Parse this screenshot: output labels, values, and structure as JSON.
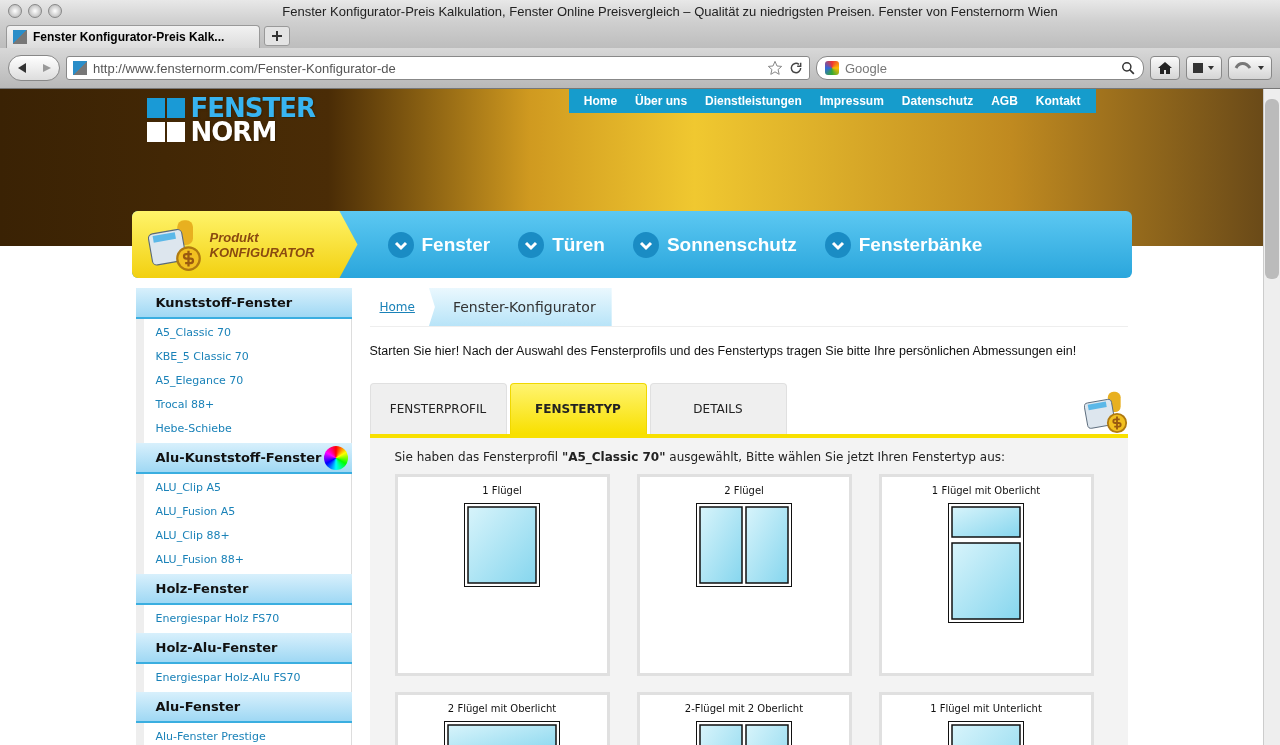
{
  "browser": {
    "window_title": "Fenster Konfigurator-Preis Kalkulation, Fenster Online Preisvergleich – Qualität zu niedrigsten Preisen. Fenster von Fensternorm Wien",
    "tab_title": "Fenster Konfigurator-Preis Kalk...",
    "url": "http://www.fensternorm.com/Fenster-Konfigurator-de",
    "search_placeholder": "Google"
  },
  "header": {
    "logo_top": "FENSTER",
    "logo_bottom": "NORM",
    "top_links": [
      "Home",
      "Über uns",
      "Dienstleistungen",
      "Impressum",
      "Datenschutz",
      "AGB",
      "Kontakt"
    ],
    "configurator_line1": "Produkt",
    "configurator_line2": "KONFIGURATOR",
    "menu": [
      "Fenster",
      "Türen",
      "Sonnenschutz",
      "Fensterbänke"
    ]
  },
  "sidebar": [
    {
      "title": "Kunststoff-Fenster",
      "items": [
        "A5_Classic 70",
        "KBE_5 Classic 70",
        "A5_Elegance 70",
        "Trocal 88+",
        "Hebe-Schiebe"
      ]
    },
    {
      "title": "Alu-Kunststoff-Fenster",
      "color_wheel": true,
      "items": [
        "ALU_Clip A5",
        "ALU_Fusion A5",
        "ALU_Clip 88+",
        "ALU_Fusion 88+"
      ]
    },
    {
      "title": "Holz-Fenster",
      "items": [
        "Energiespar Holz FS70"
      ]
    },
    {
      "title": "Holz-Alu-Fenster",
      "items": [
        "Energiespar Holz-Alu FS70"
      ]
    },
    {
      "title": "Alu-Fenster",
      "items": [
        "Alu-Fenster Prestige"
      ]
    }
  ],
  "breadcrumb": {
    "home": "Home",
    "current": "Fenster-Konfigurator"
  },
  "intro": "Starten Sie hier! Nach der Auswahl des Fensterprofils und des Fenstertyps tragen Sie bitte Ihre persönlichen Abmessungen ein!",
  "tabs": [
    {
      "label": "FENSTERPROFIL",
      "selected": false
    },
    {
      "label": "FENSTERTYP",
      "selected": true
    },
    {
      "label": "DETAILS",
      "selected": false
    }
  ],
  "prompt": "Sie haben das Fensterprofil **\"A5_Classic 70\"** ausgewählt, Bitte wählen Sie jetzt Ihren Fenstertyp aus:",
  "window_types": [
    {
      "label": "1 Flügel",
      "kind": "single"
    },
    {
      "label": "2 Flügel",
      "kind": "double"
    },
    {
      "label": "1 Flügel mit Oberlicht",
      "kind": "top-light"
    },
    {
      "label": "2 Flügel mit Oberlicht",
      "kind": "wide-top"
    },
    {
      "label": "2-Flügel mit 2 Oberlicht",
      "kind": "double"
    },
    {
      "label": "1 Flügel mit Unterlicht",
      "kind": "single"
    }
  ]
}
